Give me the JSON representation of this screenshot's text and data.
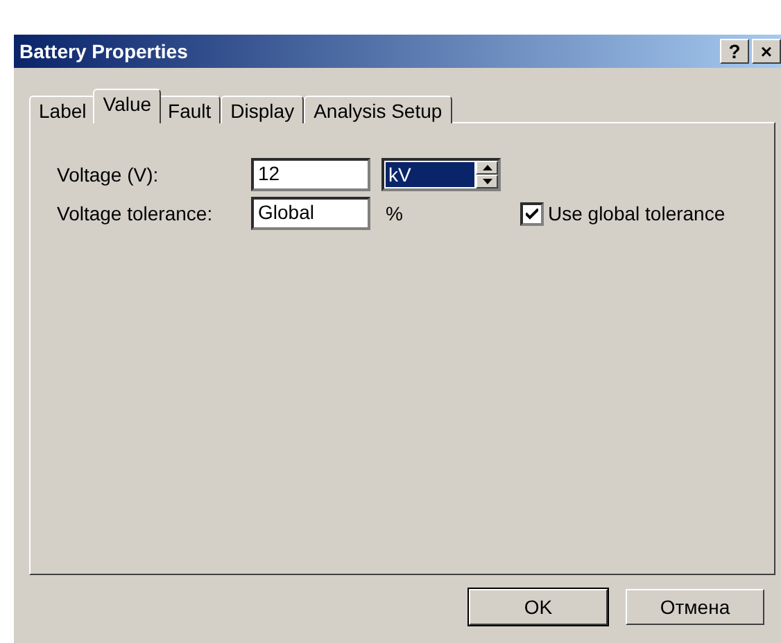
{
  "window": {
    "title": "Battery Properties",
    "help_button": "?",
    "close_button": "×"
  },
  "tabs": [
    {
      "label": "Label",
      "selected": false
    },
    {
      "label": "Value",
      "selected": true
    },
    {
      "label": "Fault",
      "selected": false
    },
    {
      "label": "Display",
      "selected": false
    },
    {
      "label": "Analysis Setup",
      "selected": false
    }
  ],
  "fields": {
    "voltage": {
      "label": "Voltage (V):",
      "value": "12",
      "unit": "kV"
    },
    "tolerance": {
      "label": "Voltage tolerance:",
      "value": "Global",
      "unit": "%"
    },
    "use_global": {
      "label": "Use global tolerance",
      "checked": true
    }
  },
  "buttons": [
    {
      "label": "OK",
      "default": true
    },
    {
      "label": "Отмена",
      "default": false
    }
  ]
}
